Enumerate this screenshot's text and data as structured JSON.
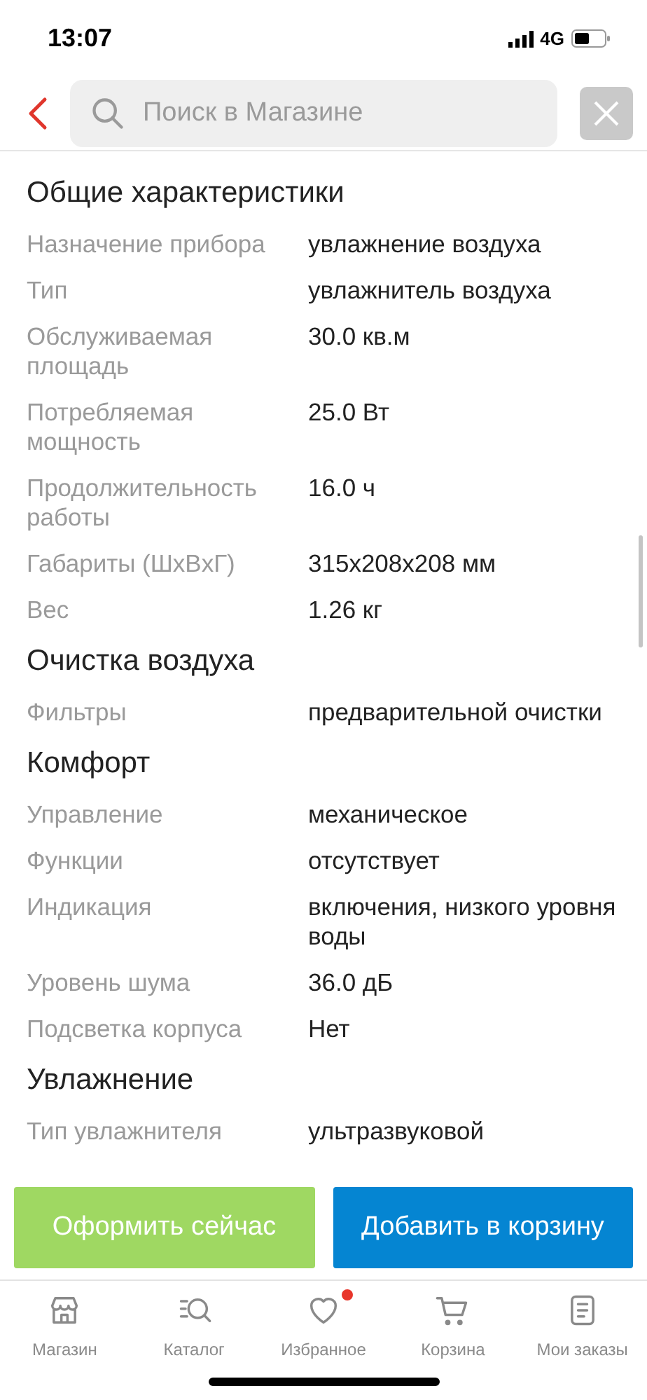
{
  "status_bar": {
    "time": "13:07",
    "network": "4G"
  },
  "header": {
    "search": {
      "placeholder": "Поиск в Магазине"
    }
  },
  "sections": [
    {
      "title": "Общие характеристики",
      "rows": [
        {
          "label": "Назначение прибора",
          "value": "увлажнение воздуха"
        },
        {
          "label": "Тип",
          "value": "увлажнитель воздуха"
        },
        {
          "label": "Обслуживаемая площадь",
          "value": "30.0 кв.м"
        },
        {
          "label": "Потребляемая мощность",
          "value": "25.0 Вт"
        },
        {
          "label": "Продолжительность работы",
          "value": "16.0 ч"
        },
        {
          "label": "Габариты (ШxВxГ)",
          "value": "315x208x208 мм"
        },
        {
          "label": "Вес",
          "value": "1.26 кг"
        }
      ]
    },
    {
      "title": "Очистка воздуха",
      "rows": [
        {
          "label": "Фильтры",
          "value": "предварительной очистки"
        }
      ]
    },
    {
      "title": "Комфорт",
      "rows": [
        {
          "label": "Управление",
          "value": "механическое"
        },
        {
          "label": "Функции",
          "value": "отсутствует"
        },
        {
          "label": "Индикация",
          "value": "включения, низкого уровня воды"
        },
        {
          "label": "Уровень шума",
          "value": "36.0 дБ"
        },
        {
          "label": "Подсветка корпуса",
          "value": "Нет"
        }
      ]
    },
    {
      "title": "Увлажнение",
      "rows": [
        {
          "label": "Тип увлажнителя",
          "value": "ультразвуковой"
        }
      ]
    }
  ],
  "actions": [
    {
      "kind": "buy",
      "label": "Оформить сейчас"
    },
    {
      "kind": "cart",
      "label": "Добавить в корзину"
    }
  ],
  "tab_bar": [
    {
      "kind": "shop",
      "label": "Магазин",
      "badge": false
    },
    {
      "kind": "catalog",
      "label": "Каталог",
      "badge": false
    },
    {
      "kind": "favorites",
      "label": "Избранное",
      "badge": true
    },
    {
      "kind": "cart",
      "label": "Корзина",
      "badge": false
    },
    {
      "kind": "orders",
      "label": "Мои заказы",
      "badge": false
    }
  ]
}
